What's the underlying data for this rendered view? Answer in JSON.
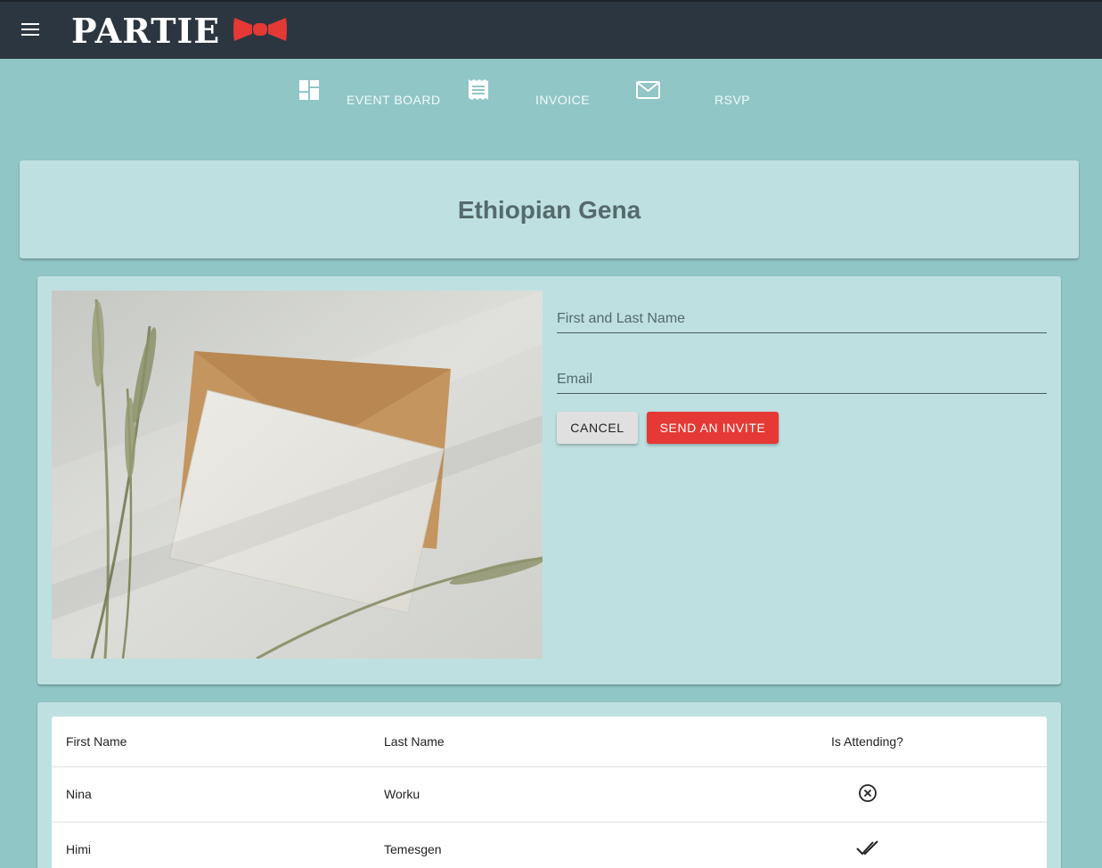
{
  "app": {
    "logo_text": "PARTIE",
    "brand_color": "#e53935",
    "header_color": "#2c3640",
    "background_color": "#91c6c7"
  },
  "nav": {
    "tabs": [
      {
        "label": "EVENT BOARD",
        "icon": "dashboard-icon"
      },
      {
        "label": "INVOICE",
        "icon": "receipt-icon"
      },
      {
        "label": "RSVP",
        "icon": "mail-icon"
      }
    ]
  },
  "event": {
    "title": "Ethiopian Gena"
  },
  "invite_form": {
    "name_placeholder": "First and Last Name",
    "email_placeholder": "Email",
    "cancel_label": "CANCEL",
    "send_label": "SEND AN INVITE",
    "image": "envelope-with-wheat-photo"
  },
  "guests": {
    "columns": [
      "First Name",
      "Last Name",
      "Is Attending?"
    ],
    "rows": [
      {
        "first": "Nina",
        "last": "Worku",
        "attending": "declined",
        "status_icon": "circle-x-icon"
      },
      {
        "first": "Himi",
        "last": "Temesgen",
        "attending": "accepted",
        "status_icon": "double-check-icon"
      }
    ]
  }
}
